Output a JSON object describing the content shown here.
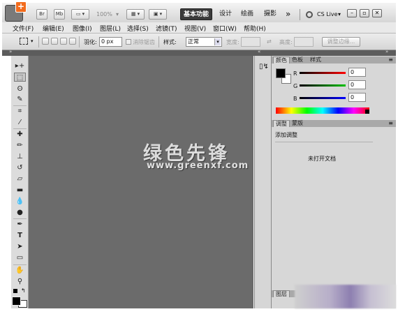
{
  "titlebar": {
    "logo_glyph": "+",
    "br_label": "Br",
    "mb_label": "Mb",
    "zoom": "100%",
    "workspaces": [
      "基本功能",
      "设计",
      "绘画",
      "摄影"
    ],
    "overflow": "»",
    "cslive": "CS Live"
  },
  "menus": [
    "文件(F)",
    "编辑(E)",
    "图像(I)",
    "图层(L)",
    "选择(S)",
    "滤镜(T)",
    "视图(V)",
    "窗口(W)",
    "帮助(H)"
  ],
  "options": {
    "feather_label": "羽化:",
    "feather_value": "0 px",
    "antialias_label": "消除锯齿",
    "style_label": "样式:",
    "style_value": "正常",
    "width_label": "宽度:",
    "height_label": "高度:",
    "refine_label": "调整边缘..."
  },
  "watermark": {
    "text": "绿色先锋",
    "url": "www.greenxf.com"
  },
  "color_panel": {
    "tabs": [
      "颜色",
      "色板",
      "样式"
    ],
    "channels": [
      {
        "label": "R",
        "value": "0",
        "color": "#d40000"
      },
      {
        "label": "G",
        "value": "0",
        "color": "#00a800"
      },
      {
        "label": "B",
        "value": "0",
        "color": "#0000d0"
      }
    ]
  },
  "adjust_panel": {
    "tabs": [
      "调整",
      "蒙版"
    ],
    "title": "添加调整",
    "message": "未打开文档"
  },
  "layers_tab": "图层"
}
